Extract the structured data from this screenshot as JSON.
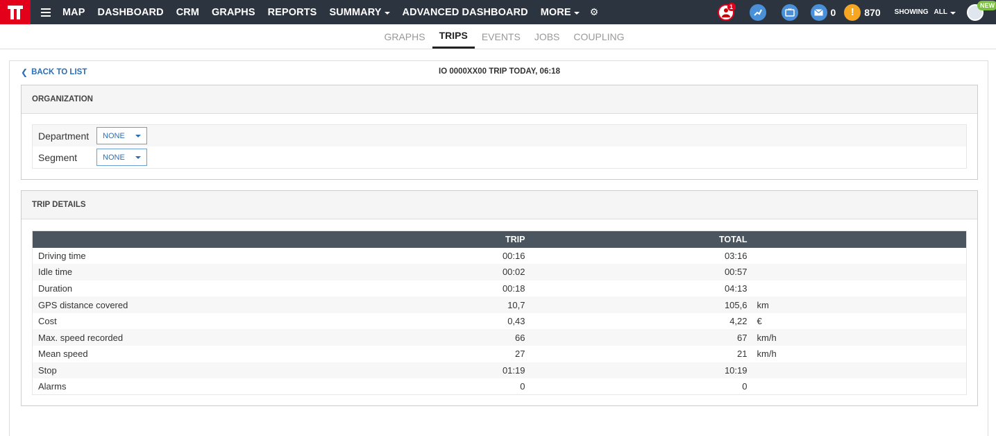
{
  "nav": {
    "items": [
      {
        "label": "MAP",
        "dropdown": false
      },
      {
        "label": "DASHBOARD",
        "dropdown": false
      },
      {
        "label": "CRM",
        "dropdown": false
      },
      {
        "label": "GRAPHS",
        "dropdown": false
      },
      {
        "label": "REPORTS",
        "dropdown": false
      },
      {
        "label": "SUMMARY",
        "dropdown": true
      },
      {
        "label": "ADVANCED DASHBOARD",
        "dropdown": false
      },
      {
        "label": "MORE",
        "dropdown": true
      }
    ],
    "alert_badge": "1",
    "messages_count": "0",
    "warnings_count": "870",
    "showing_label": "SHOWING",
    "showing_value": "ALL",
    "new_badge": "NEW",
    "warning_glyph": "!"
  },
  "subtabs": [
    {
      "label": "GRAPHS",
      "active": false
    },
    {
      "label": "TRIPS",
      "active": true
    },
    {
      "label": "EVENTS",
      "active": false
    },
    {
      "label": "JOBS",
      "active": false
    },
    {
      "label": "COUPLING",
      "active": false
    }
  ],
  "header": {
    "back_label": "BACK TO LIST",
    "title": "IO 0000XX00 TRIP TODAY, 06:18"
  },
  "organization": {
    "heading": "ORGANIZATION",
    "fields": [
      {
        "label": "Department",
        "value": "NONE"
      },
      {
        "label": "Segment",
        "value": "NONE"
      }
    ]
  },
  "trip_details": {
    "heading": "TRIP DETAILS",
    "columns": {
      "label": "",
      "trip": "TRIP",
      "total": "TOTAL",
      "unit": ""
    },
    "rows": [
      {
        "label": "Driving time",
        "trip": "00:16",
        "total": "03:16",
        "unit": ""
      },
      {
        "label": "Idle time",
        "trip": "00:02",
        "total": "00:57",
        "unit": ""
      },
      {
        "label": "Duration",
        "trip": "00:18",
        "total": "04:13",
        "unit": ""
      },
      {
        "label": "GPS distance covered",
        "trip": "10,7",
        "total": "105,6",
        "unit": "km"
      },
      {
        "label": "Cost",
        "trip": "0,43",
        "total": "4,22",
        "unit": "€"
      },
      {
        "label": "Max. speed recorded",
        "trip": "66",
        "total": "67",
        "unit": "km/h"
      },
      {
        "label": "Mean speed",
        "trip": "27",
        "total": "21",
        "unit": "km/h"
      },
      {
        "label": "Stop",
        "trip": "01:19",
        "total": "10:19",
        "unit": ""
      },
      {
        "label": "Alarms",
        "trip": "0",
        "total": "0",
        "unit": ""
      }
    ]
  },
  "colors": {
    "navbar": "#2c3440",
    "brand_red": "#e2001a",
    "link_blue": "#2a6eb6",
    "table_header": "#4a5560"
  }
}
